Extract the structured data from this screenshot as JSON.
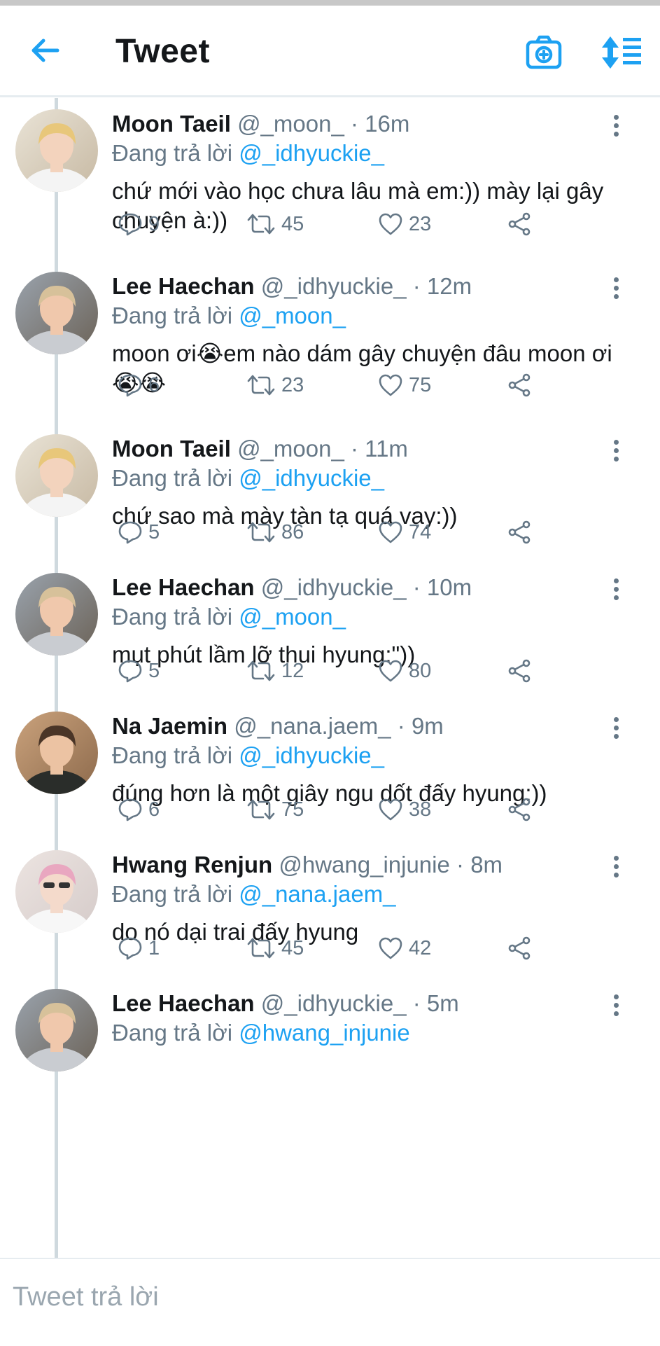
{
  "header": {
    "title": "Tweet",
    "back_icon": "arrow-left-icon",
    "camera_icon": "camera-plus-icon",
    "sort_icon": "sort-list-icon",
    "accent": "#1da1f2"
  },
  "reply_prefix": "Đang trả lời",
  "tweets": [
    {
      "name": "Moon Taeil",
      "handle": "@_moon_",
      "sep": "·",
      "time": "16m",
      "reply_to": "@_idhyuckie_",
      "text": "chứ mới vào học chưa lâu mà em:)) mày lại gây chuyện à:))",
      "replies": "9",
      "retweets": "45",
      "likes": "23"
    },
    {
      "name": "Lee Haechan",
      "handle": "@_idhyuckie_",
      "sep": "·",
      "time": "12m",
      "reply_to": "@_moon_",
      "text": "moon ơi😭em nào dám gây chuyện đâu moon ơi😭😭",
      "replies": "6",
      "retweets": "23",
      "likes": "75"
    },
    {
      "name": "Moon Taeil",
      "handle": "@_moon_",
      "sep": "·",
      "time": "11m",
      "reply_to": "@_idhyuckie_",
      "text": "chứ sao mà mày tàn tạ quá vạy:))",
      "replies": "5",
      "retweets": "86",
      "likes": "74"
    },
    {
      "name": "Lee Haechan",
      "handle": "@_idhyuckie_",
      "sep": "·",
      "time": "10m",
      "reply_to": "@_moon_",
      "text": "mụt phút lầm lỡ thui hyung:\"))",
      "replies": "5",
      "retweets": "12",
      "likes": "80"
    },
    {
      "name": "Na Jaemin",
      "handle": "@_nana.jaem_",
      "sep": "·",
      "time": "9m",
      "reply_to": "@_idhyuckie_",
      "text": "đúng hơn là một giây ngu dốt đấy hyung:))",
      "replies": "6",
      "retweets": "75",
      "likes": "38"
    },
    {
      "name": "Hwang Renjun",
      "handle": "@hwang_injunie",
      "sep": "·",
      "time": "8m",
      "reply_to": "@_nana.jaem_",
      "text": "do nó dại trai đấy hyung",
      "replies": "1",
      "retweets": "45",
      "likes": "42"
    },
    {
      "name": "Lee Haechan",
      "handle": "@_idhyuckie_",
      "sep": "·",
      "time": "5m",
      "reply_to": "@hwang_injunie",
      "text": "",
      "replies": "",
      "retweets": "",
      "likes": ""
    }
  ],
  "compose": {
    "placeholder": "Tweet trả lời"
  }
}
